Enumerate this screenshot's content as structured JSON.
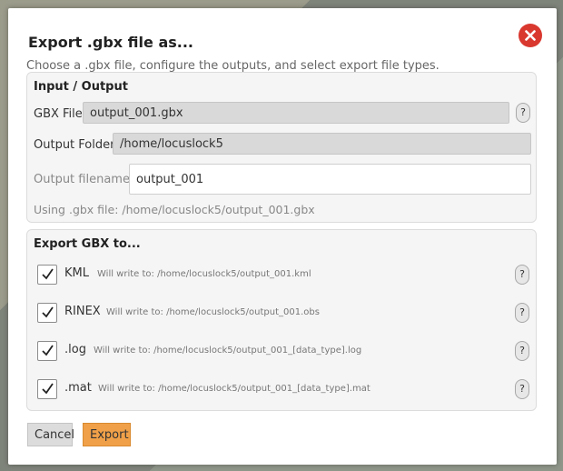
{
  "dialog": {
    "title": "Export .gbx file as...",
    "subtitle": "Choose a .gbx file, configure the outputs, and select export file types."
  },
  "io": {
    "heading": "Input / Output",
    "gbx_label": "GBX File:",
    "gbx_value": "output_001.gbx",
    "folder_label": "Output Folder:",
    "folder_value": "/home/locuslock5",
    "filename_label": "Output filename:",
    "filename_value": "output_001",
    "using_text": "Using .gbx file: /home/locuslock5/output_001.gbx",
    "help": "?"
  },
  "export": {
    "heading": "Export GBX to...",
    "items": [
      {
        "label": "KML",
        "path": "Will write to: /home/locuslock5/output_001.kml",
        "checked": true,
        "help": "?"
      },
      {
        "label": "RINEX",
        "path": "Will write to: /home/locuslock5/output_001.obs",
        "checked": true,
        "help": "?"
      },
      {
        "label": ".log",
        "path": "Will write to: /home/locuslock5/output_001_[data_type].log",
        "checked": true,
        "help": "?"
      },
      {
        "label": ".mat",
        "path": "Will write to: /home/locuslock5/output_001_[data_type].mat",
        "checked": true,
        "help": "?"
      }
    ]
  },
  "buttons": {
    "cancel": "Cancel",
    "export": "Export"
  },
  "colors": {
    "accent": "#f0a048",
    "close": "#d9382f"
  },
  "icons": {
    "close": "close-icon",
    "check": "checkmark-icon",
    "help": "help-icon"
  }
}
